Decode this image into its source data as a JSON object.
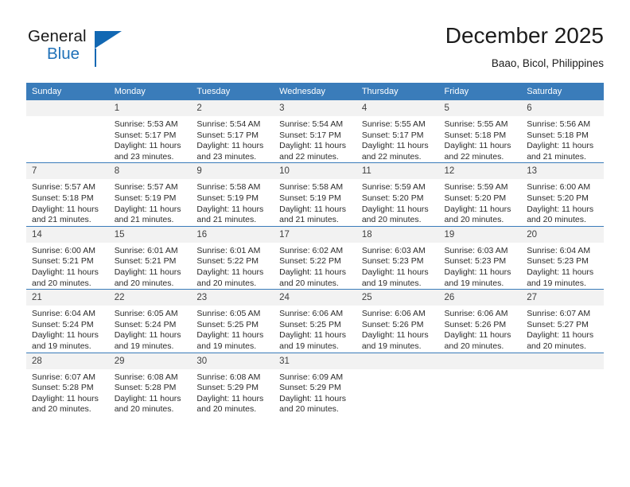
{
  "brand": {
    "name_top": "General",
    "name_bottom": "Blue",
    "accent_color": "#1268b3",
    "text_color": "#1a1a1a"
  },
  "header": {
    "title": "December 2025",
    "location": "Baao, Bicol, Philippines"
  },
  "theme": {
    "header_blue": "#3a7cba",
    "daynum_band": "#f2f2f2",
    "body_text": "#2b2b2b"
  },
  "weekday_headers": [
    "Sunday",
    "Monday",
    "Tuesday",
    "Wednesday",
    "Thursday",
    "Friday",
    "Saturday"
  ],
  "weeks": [
    [
      {
        "day": "",
        "sunrise": "",
        "sunset": "",
        "daylight_1": "",
        "daylight_2": "",
        "blank": true
      },
      {
        "day": "1",
        "sunrise": "Sunrise: 5:53 AM",
        "sunset": "Sunset: 5:17 PM",
        "daylight_1": "Daylight: 11 hours",
        "daylight_2": "and 23 minutes."
      },
      {
        "day": "2",
        "sunrise": "Sunrise: 5:54 AM",
        "sunset": "Sunset: 5:17 PM",
        "daylight_1": "Daylight: 11 hours",
        "daylight_2": "and 23 minutes."
      },
      {
        "day": "3",
        "sunrise": "Sunrise: 5:54 AM",
        "sunset": "Sunset: 5:17 PM",
        "daylight_1": "Daylight: 11 hours",
        "daylight_2": "and 22 minutes."
      },
      {
        "day": "4",
        "sunrise": "Sunrise: 5:55 AM",
        "sunset": "Sunset: 5:17 PM",
        "daylight_1": "Daylight: 11 hours",
        "daylight_2": "and 22 minutes."
      },
      {
        "day": "5",
        "sunrise": "Sunrise: 5:55 AM",
        "sunset": "Sunset: 5:18 PM",
        "daylight_1": "Daylight: 11 hours",
        "daylight_2": "and 22 minutes."
      },
      {
        "day": "6",
        "sunrise": "Sunrise: 5:56 AM",
        "sunset": "Sunset: 5:18 PM",
        "daylight_1": "Daylight: 11 hours",
        "daylight_2": "and 21 minutes."
      }
    ],
    [
      {
        "day": "7",
        "sunrise": "Sunrise: 5:57 AM",
        "sunset": "Sunset: 5:18 PM",
        "daylight_1": "Daylight: 11 hours",
        "daylight_2": "and 21 minutes."
      },
      {
        "day": "8",
        "sunrise": "Sunrise: 5:57 AM",
        "sunset": "Sunset: 5:19 PM",
        "daylight_1": "Daylight: 11 hours",
        "daylight_2": "and 21 minutes."
      },
      {
        "day": "9",
        "sunrise": "Sunrise: 5:58 AM",
        "sunset": "Sunset: 5:19 PM",
        "daylight_1": "Daylight: 11 hours",
        "daylight_2": "and 21 minutes."
      },
      {
        "day": "10",
        "sunrise": "Sunrise: 5:58 AM",
        "sunset": "Sunset: 5:19 PM",
        "daylight_1": "Daylight: 11 hours",
        "daylight_2": "and 21 minutes."
      },
      {
        "day": "11",
        "sunrise": "Sunrise: 5:59 AM",
        "sunset": "Sunset: 5:20 PM",
        "daylight_1": "Daylight: 11 hours",
        "daylight_2": "and 20 minutes."
      },
      {
        "day": "12",
        "sunrise": "Sunrise: 5:59 AM",
        "sunset": "Sunset: 5:20 PM",
        "daylight_1": "Daylight: 11 hours",
        "daylight_2": "and 20 minutes."
      },
      {
        "day": "13",
        "sunrise": "Sunrise: 6:00 AM",
        "sunset": "Sunset: 5:20 PM",
        "daylight_1": "Daylight: 11 hours",
        "daylight_2": "and 20 minutes."
      }
    ],
    [
      {
        "day": "14",
        "sunrise": "Sunrise: 6:00 AM",
        "sunset": "Sunset: 5:21 PM",
        "daylight_1": "Daylight: 11 hours",
        "daylight_2": "and 20 minutes."
      },
      {
        "day": "15",
        "sunrise": "Sunrise: 6:01 AM",
        "sunset": "Sunset: 5:21 PM",
        "daylight_1": "Daylight: 11 hours",
        "daylight_2": "and 20 minutes."
      },
      {
        "day": "16",
        "sunrise": "Sunrise: 6:01 AM",
        "sunset": "Sunset: 5:22 PM",
        "daylight_1": "Daylight: 11 hours",
        "daylight_2": "and 20 minutes."
      },
      {
        "day": "17",
        "sunrise": "Sunrise: 6:02 AM",
        "sunset": "Sunset: 5:22 PM",
        "daylight_1": "Daylight: 11 hours",
        "daylight_2": "and 20 minutes."
      },
      {
        "day": "18",
        "sunrise": "Sunrise: 6:03 AM",
        "sunset": "Sunset: 5:23 PM",
        "daylight_1": "Daylight: 11 hours",
        "daylight_2": "and 19 minutes."
      },
      {
        "day": "19",
        "sunrise": "Sunrise: 6:03 AM",
        "sunset": "Sunset: 5:23 PM",
        "daylight_1": "Daylight: 11 hours",
        "daylight_2": "and 19 minutes."
      },
      {
        "day": "20",
        "sunrise": "Sunrise: 6:04 AM",
        "sunset": "Sunset: 5:23 PM",
        "daylight_1": "Daylight: 11 hours",
        "daylight_2": "and 19 minutes."
      }
    ],
    [
      {
        "day": "21",
        "sunrise": "Sunrise: 6:04 AM",
        "sunset": "Sunset: 5:24 PM",
        "daylight_1": "Daylight: 11 hours",
        "daylight_2": "and 19 minutes."
      },
      {
        "day": "22",
        "sunrise": "Sunrise: 6:05 AM",
        "sunset": "Sunset: 5:24 PM",
        "daylight_1": "Daylight: 11 hours",
        "daylight_2": "and 19 minutes."
      },
      {
        "day": "23",
        "sunrise": "Sunrise: 6:05 AM",
        "sunset": "Sunset: 5:25 PM",
        "daylight_1": "Daylight: 11 hours",
        "daylight_2": "and 19 minutes."
      },
      {
        "day": "24",
        "sunrise": "Sunrise: 6:06 AM",
        "sunset": "Sunset: 5:25 PM",
        "daylight_1": "Daylight: 11 hours",
        "daylight_2": "and 19 minutes."
      },
      {
        "day": "25",
        "sunrise": "Sunrise: 6:06 AM",
        "sunset": "Sunset: 5:26 PM",
        "daylight_1": "Daylight: 11 hours",
        "daylight_2": "and 19 minutes."
      },
      {
        "day": "26",
        "sunrise": "Sunrise: 6:06 AM",
        "sunset": "Sunset: 5:26 PM",
        "daylight_1": "Daylight: 11 hours",
        "daylight_2": "and 20 minutes."
      },
      {
        "day": "27",
        "sunrise": "Sunrise: 6:07 AM",
        "sunset": "Sunset: 5:27 PM",
        "daylight_1": "Daylight: 11 hours",
        "daylight_2": "and 20 minutes."
      }
    ],
    [
      {
        "day": "28",
        "sunrise": "Sunrise: 6:07 AM",
        "sunset": "Sunset: 5:28 PM",
        "daylight_1": "Daylight: 11 hours",
        "daylight_2": "and 20 minutes."
      },
      {
        "day": "29",
        "sunrise": "Sunrise: 6:08 AM",
        "sunset": "Sunset: 5:28 PM",
        "daylight_1": "Daylight: 11 hours",
        "daylight_2": "and 20 minutes."
      },
      {
        "day": "30",
        "sunrise": "Sunrise: 6:08 AM",
        "sunset": "Sunset: 5:29 PM",
        "daylight_1": "Daylight: 11 hours",
        "daylight_2": "and 20 minutes."
      },
      {
        "day": "31",
        "sunrise": "Sunrise: 6:09 AM",
        "sunset": "Sunset: 5:29 PM",
        "daylight_1": "Daylight: 11 hours",
        "daylight_2": "and 20 minutes."
      },
      {
        "day": "",
        "sunrise": "",
        "sunset": "",
        "daylight_1": "",
        "daylight_2": "",
        "blank": true
      },
      {
        "day": "",
        "sunrise": "",
        "sunset": "",
        "daylight_1": "",
        "daylight_2": "",
        "blank": true
      },
      {
        "day": "",
        "sunrise": "",
        "sunset": "",
        "daylight_1": "",
        "daylight_2": "",
        "blank": true
      }
    ]
  ]
}
